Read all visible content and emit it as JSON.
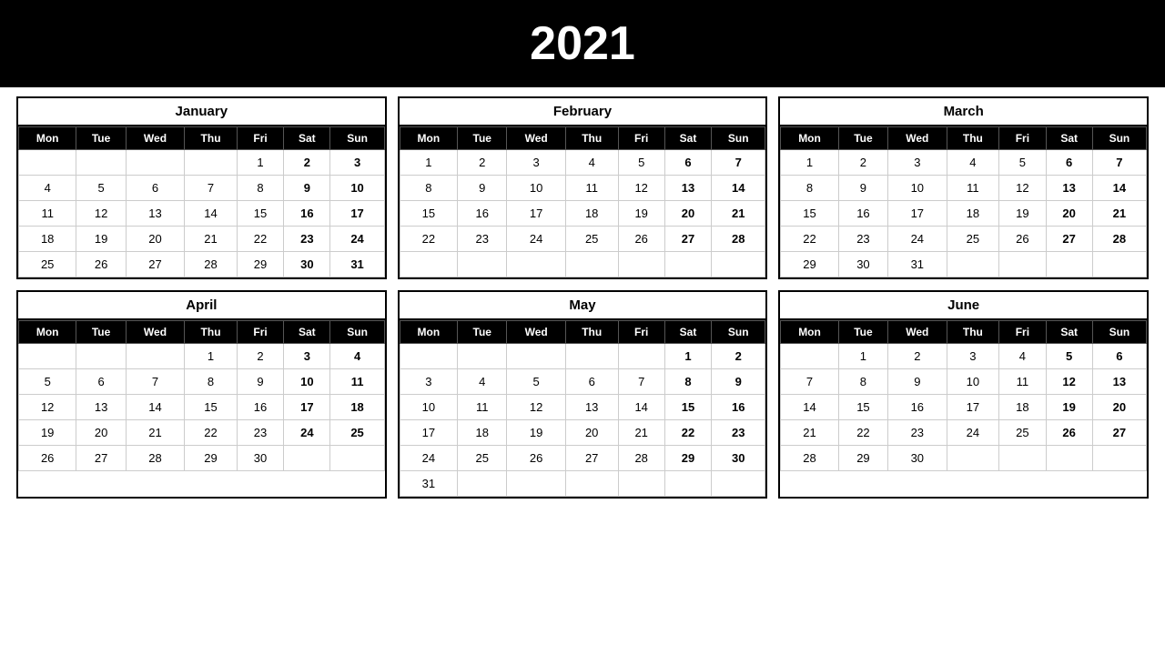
{
  "year": "2021",
  "months": [
    {
      "name": "January",
      "days_header": [
        "Mon",
        "Tue",
        "Wed",
        "Thu",
        "Fri",
        "Sat",
        "Sun"
      ],
      "weeks": [
        [
          "",
          "",
          "",
          "",
          "1",
          "2",
          "3"
        ],
        [
          "4",
          "5",
          "6",
          "7",
          "8",
          "9",
          "10"
        ],
        [
          "11",
          "12",
          "13",
          "14",
          "15",
          "16",
          "17"
        ],
        [
          "18",
          "19",
          "20",
          "21",
          "22",
          "23",
          "24"
        ],
        [
          "25",
          "26",
          "27",
          "28",
          "29",
          "30",
          "31"
        ]
      ]
    },
    {
      "name": "February",
      "days_header": [
        "Mon",
        "Tue",
        "Wed",
        "Thu",
        "Fri",
        "Sat",
        "Sun"
      ],
      "weeks": [
        [
          "1",
          "2",
          "3",
          "4",
          "5",
          "6",
          "7"
        ],
        [
          "8",
          "9",
          "10",
          "11",
          "12",
          "13",
          "14"
        ],
        [
          "15",
          "16",
          "17",
          "18",
          "19",
          "20",
          "21"
        ],
        [
          "22",
          "23",
          "24",
          "25",
          "26",
          "27",
          "28"
        ],
        [
          "",
          "",
          "",
          "",
          "",
          "",
          ""
        ]
      ]
    },
    {
      "name": "March",
      "days_header": [
        "Mon",
        "Tue",
        "Wed",
        "Thu",
        "Fri",
        "Sat",
        "Sun"
      ],
      "weeks": [
        [
          "1",
          "2",
          "3",
          "4",
          "5",
          "6",
          "7"
        ],
        [
          "8",
          "9",
          "10",
          "11",
          "12",
          "13",
          "14"
        ],
        [
          "15",
          "16",
          "17",
          "18",
          "19",
          "20",
          "21"
        ],
        [
          "22",
          "23",
          "24",
          "25",
          "26",
          "27",
          "28"
        ],
        [
          "29",
          "30",
          "31",
          "",
          "",
          "",
          ""
        ]
      ]
    },
    {
      "name": "April",
      "days_header": [
        "Mon",
        "Tue",
        "Wed",
        "Thu",
        "Fri",
        "Sat",
        "Sun"
      ],
      "weeks": [
        [
          "",
          "",
          "",
          "1",
          "2",
          "3",
          "4"
        ],
        [
          "5",
          "6",
          "7",
          "8",
          "9",
          "10",
          "11"
        ],
        [
          "12",
          "13",
          "14",
          "15",
          "16",
          "17",
          "18"
        ],
        [
          "19",
          "20",
          "21",
          "22",
          "23",
          "24",
          "25"
        ],
        [
          "26",
          "27",
          "28",
          "29",
          "30",
          "",
          ""
        ]
      ]
    },
    {
      "name": "May",
      "days_header": [
        "Mon",
        "Tue",
        "Wed",
        "Thu",
        "Fri",
        "Sat",
        "Sun"
      ],
      "weeks": [
        [
          "",
          "",
          "",
          "",
          "",
          "1",
          "2"
        ],
        [
          "3",
          "4",
          "5",
          "6",
          "7",
          "8",
          "9"
        ],
        [
          "10",
          "11",
          "12",
          "13",
          "14",
          "15",
          "16"
        ],
        [
          "17",
          "18",
          "19",
          "20",
          "21",
          "22",
          "23"
        ],
        [
          "24",
          "25",
          "26",
          "27",
          "28",
          "29",
          "30"
        ],
        [
          "31",
          "",
          "",
          "",
          "",
          "",
          ""
        ]
      ]
    },
    {
      "name": "June",
      "days_header": [
        "Mon",
        "Tue",
        "Wed",
        "Thu",
        "Fri",
        "Sat",
        "Sun"
      ],
      "weeks": [
        [
          "",
          "1",
          "2",
          "3",
          "4",
          "5",
          "6"
        ],
        [
          "7",
          "8",
          "9",
          "10",
          "11",
          "12",
          "13"
        ],
        [
          "14",
          "15",
          "16",
          "17",
          "18",
          "19",
          "20"
        ],
        [
          "21",
          "22",
          "23",
          "24",
          "25",
          "26",
          "27"
        ],
        [
          "28",
          "29",
          "30",
          "",
          "",
          "",
          ""
        ]
      ]
    }
  ]
}
